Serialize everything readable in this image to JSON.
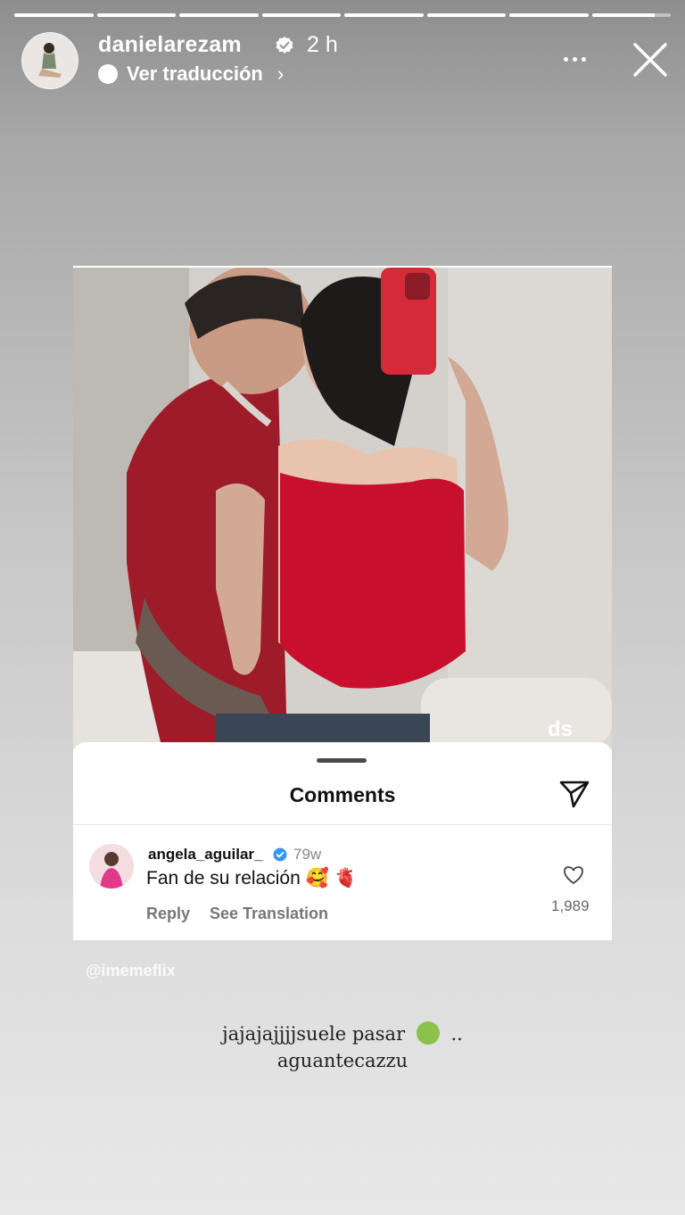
{
  "story": {
    "progress_segments": [
      1,
      1,
      1,
      1,
      1,
      1,
      1,
      0.8
    ],
    "username": "danielarezam",
    "time_ago": "2 h",
    "translate_label": "Ver traducción",
    "translate_chevron": "›"
  },
  "post": {
    "photo_watermark": "ds",
    "sheet_title": "Comments",
    "comment": {
      "username": "angela_aguilar_",
      "time": "79w",
      "text": "Fan de su relación 🥰 🫀",
      "reply_label": "Reply",
      "translation_label": "See Translation",
      "likes": "1,989"
    }
  },
  "watermark": "@imemeflix",
  "caption": {
    "line1_a": "jajajajjjjsuele pasar",
    "line1_b": "..",
    "line2": "aguantecazzu"
  },
  "colors": {
    "verified_blue": "#3897f0",
    "dress_red": "#c8102e"
  }
}
